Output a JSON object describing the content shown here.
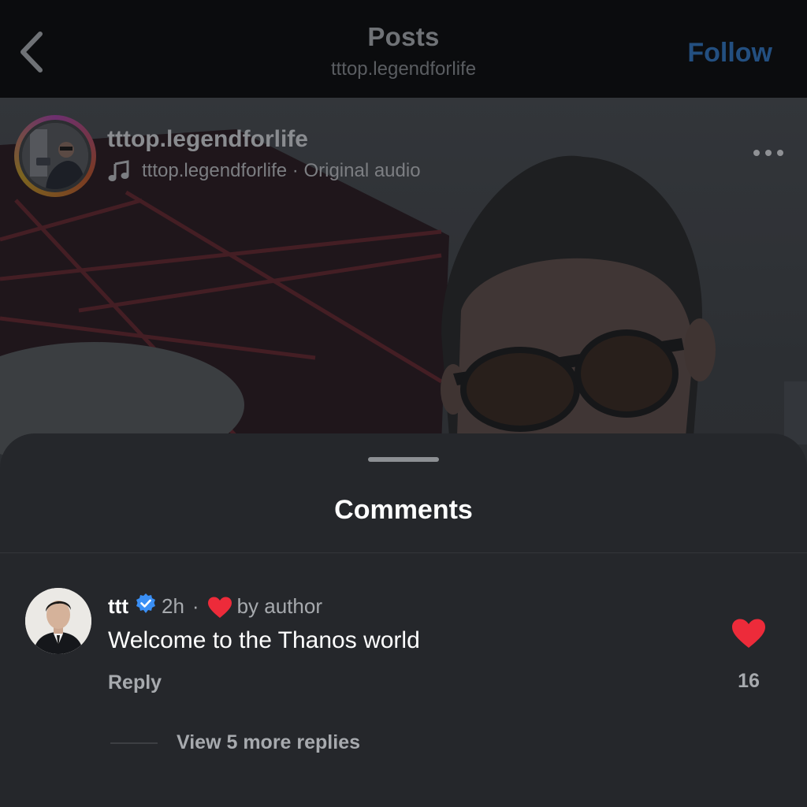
{
  "nav": {
    "title": "Posts",
    "subtitle": "tttop.legendforlife",
    "follow_label": "Follow"
  },
  "post": {
    "username": "tttop.legendforlife",
    "audio_text": "tttop.legendforlife · Original audio"
  },
  "comments_sheet": {
    "title": "Comments",
    "comments": [
      {
        "username": "ttt",
        "verified": true,
        "time": "2h",
        "separator": "·",
        "liked_by_author_text": "by author",
        "text": "Welcome to the Thanos world",
        "reply_label": "Reply",
        "like_count": "16",
        "view_replies_label": "View 5 more replies"
      }
    ]
  },
  "colors": {
    "accent_blue": "#234f80",
    "heart_red": "#ed2b3a",
    "sheet_bg": "#25272b",
    "verified_blue": "#3a8ff5"
  },
  "icons": {
    "back": "chevron-left-icon",
    "music": "music-note-icon",
    "more": "more-horizontal-icon",
    "verified": "verified-badge-icon",
    "heart": "heart-icon"
  }
}
